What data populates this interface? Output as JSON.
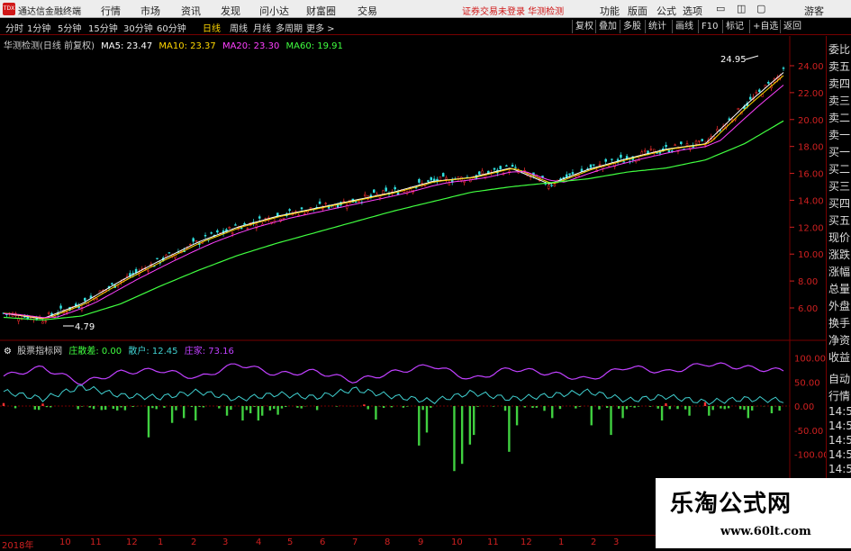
{
  "titlebar": {
    "app_title": "通达信金融终端",
    "menus": [
      "行情",
      "市场",
      "资讯",
      "发现",
      "问小达",
      "财富圈",
      "交易"
    ],
    "notice": "证券交易未登录  华测检测",
    "right_menus": [
      "功能",
      "版面",
      "公式",
      "选项"
    ],
    "user": "游客",
    "logo_text": "TDX"
  },
  "periods": [
    "分时",
    "1分钟",
    "5分钟",
    "15分钟",
    "30分钟",
    "60分钟",
    "日线",
    "周线",
    "月线",
    "多周期",
    "更多 >"
  ],
  "active_period": "日线",
  "toolbar": [
    "复权",
    "叠加",
    "多股",
    "统计",
    "画线",
    "F10",
    "标记",
    "+自选",
    "返回"
  ],
  "price_panel": {
    "stock": "华测检测(日线 前复权)",
    "ma": [
      {
        "label": "MA5: 23.47",
        "color": "#ffffff"
      },
      {
        "label": "MA10: 23.37",
        "color": "#ffd700"
      },
      {
        "label": "MA20: 23.30",
        "color": "#ff40ff"
      },
      {
        "label": "MA60: 19.91",
        "color": "#40ff40"
      }
    ],
    "high_label": "24.95",
    "low_label": "4.79",
    "y_ticks": [
      "24.00",
      "22.00",
      "20.00",
      "18.00",
      "16.00",
      "14.00",
      "12.00",
      "10.00",
      "8.00",
      "6.00"
    ],
    "y_values": [
      24,
      22,
      20,
      18,
      16,
      14,
      12,
      10,
      8,
      6
    ]
  },
  "indicator_panel": {
    "name": "股票指标网",
    "items": [
      {
        "label": "庄散差: 0.00",
        "color": "#40ff40"
      },
      {
        "label": "散户: 12.45",
        "color": "#40d0d0"
      },
      {
        "label": "庄家: 73.16",
        "color": "#c040ff"
      }
    ],
    "y_ticks": [
      "100.00",
      "50.00",
      "0.00",
      "-50.00",
      "-100.00"
    ],
    "y_values": [
      100,
      50,
      0,
      -50,
      -100
    ]
  },
  "x_axis": [
    "2018年",
    "10",
    "11",
    "12",
    "1",
    "2",
    "3",
    "4",
    "5",
    "6",
    "7",
    "8",
    "9",
    "10",
    "11",
    "12",
    "1",
    "2",
    "3"
  ],
  "sidebar": [
    "委比",
    "卖五",
    "卖四",
    "卖三",
    "卖二",
    "卖一",
    "买一",
    "买二",
    "买三",
    "买四",
    "买五",
    "现价",
    "涨跌",
    "涨幅",
    "总量",
    "外盘",
    "换手",
    "净资",
    "收益",
    "自动",
    "行情",
    "14:50",
    "14:50",
    "14:50",
    "14:50",
    "14:50",
    "14:50",
    "14:50",
    "14:50"
  ],
  "watermark": {
    "title": "乐淘公式网",
    "url": "www.60lt.com"
  },
  "chart_data": {
    "type": "line",
    "x": [
      0,
      10,
      20,
      30,
      40,
      50,
      60,
      70,
      80,
      90,
      100,
      110,
      120,
      130,
      140,
      150,
      160,
      170,
      180,
      190,
      200
    ],
    "series": [
      {
        "name": "MA5",
        "values": [
          5.6,
          5.2,
          6.3,
          8.0,
          9.5,
          10.9,
          12.0,
          12.8,
          13.4,
          14.0,
          14.6,
          15.4,
          15.7,
          16.4,
          15.2,
          16.3,
          17.1,
          17.8,
          18.2,
          21.0,
          23.5
        ]
      },
      {
        "name": "MA60",
        "values": [
          5.3,
          5.1,
          5.4,
          6.3,
          7.6,
          8.8,
          9.9,
          10.8,
          11.6,
          12.4,
          13.2,
          13.9,
          14.6,
          15.0,
          15.3,
          15.6,
          16.1,
          16.4,
          17.0,
          18.2,
          19.9
        ]
      },
      {
        "name": "散户",
        "values": [
          30,
          15,
          40,
          22,
          18,
          30,
          14,
          25,
          18,
          35,
          20,
          10,
          28,
          15,
          22,
          30,
          12,
          20,
          8,
          15,
          12
        ]
      },
      {
        "name": "庄家",
        "values": [
          62,
          80,
          48,
          70,
          75,
          58,
          88,
          66,
          72,
          52,
          70,
          85,
          55,
          78,
          68,
          55,
          82,
          70,
          88,
          80,
          73
        ]
      }
    ],
    "ylim": [
      4,
      25
    ]
  }
}
